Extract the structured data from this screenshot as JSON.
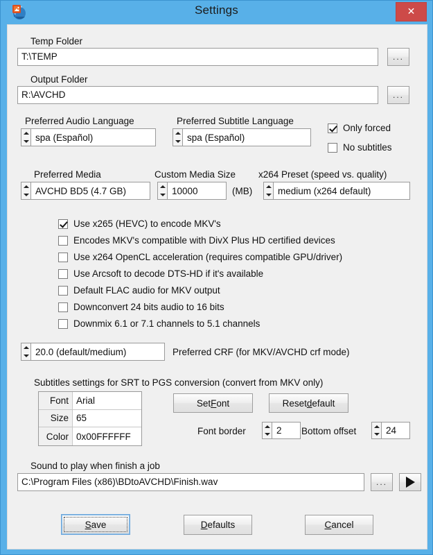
{
  "window": {
    "title": "Settings",
    "close_label": "✕",
    "app_icon": "bdtoavchd-app-icon",
    "accent_color": "#58b0e8",
    "close_color": "#cd4a48",
    "client_bg": "#f0f0f0"
  },
  "temp_folder": {
    "label": "Temp Folder",
    "value": "T:\\TEMP",
    "browse_label": "..."
  },
  "output_folder": {
    "label": "Output Folder",
    "value": "R:\\AVCHD",
    "browse_label": "..."
  },
  "audio_language": {
    "label": "Preferred Audio Language",
    "value": "spa (Español)"
  },
  "subtitle_language": {
    "label": "Preferred Subtitle Language",
    "value": "spa (Español)"
  },
  "subtitle_options": [
    {
      "label": "Only forced",
      "checked": true
    },
    {
      "label": "No subtitles",
      "checked": false
    }
  ],
  "preferred_media": {
    "label": "Preferred Media",
    "value": "AVCHD BD5 (4.7 GB)"
  },
  "custom_media_size": {
    "label": "Custom Media Size",
    "value": "10000",
    "unit": "(MB)"
  },
  "x264_preset": {
    "label": "x264 Preset (speed vs. quality)",
    "value": "medium (x264 default)"
  },
  "encode_options": [
    {
      "label": "Use x265 (HEVC) to encode MKV's",
      "checked": true
    },
    {
      "label": "Encodes MKV's compatible with DivX Plus HD certified devices",
      "checked": false
    },
    {
      "label": "Use x264 OpenCL acceleration (requires compatible GPU/driver)",
      "checked": false
    },
    {
      "label": "Use Arcsoft to decode DTS-HD if it's available",
      "checked": false
    },
    {
      "label": "Default FLAC audio for MKV output",
      "checked": false
    },
    {
      "label": "Downconvert 24 bits audio to 16 bits",
      "checked": false
    },
    {
      "label": "Downmix 6.1 or 7.1 channels to 5.1 channels",
      "checked": false
    }
  ],
  "crf": {
    "value": "20.0 (default/medium)",
    "label": "Preferred CRF (for MKV/AVCHD crf mode)"
  },
  "subtitles_section": {
    "heading": "Subtitles settings for SRT to PGS conversion (convert from MKV only)",
    "rows": [
      {
        "key": "Font",
        "value": "Arial"
      },
      {
        "key": "Size",
        "value": "65"
      },
      {
        "key": "Color",
        "value": "0x00FFFFFF"
      }
    ],
    "set_font_button": {
      "pre": "Set ",
      "accel": "F",
      "post": "ont"
    },
    "reset_default_button": {
      "pre": "Reset ",
      "accel": "d",
      "post": "efault"
    },
    "font_border": {
      "label": "Font border",
      "value": "2"
    },
    "bottom_offset": {
      "label": "Bottom offset",
      "value": "24"
    }
  },
  "sound": {
    "label": "Sound to play when finish a job",
    "value": "C:\\Program Files (x86)\\BDtoAVCHD\\Finish.wav",
    "browse_label": "...",
    "play_icon": "play-triangle-icon"
  },
  "footer": {
    "save": {
      "pre": "",
      "accel": "S",
      "post": "ave"
    },
    "defaults": {
      "pre": "",
      "accel": "D",
      "post": "efaults"
    },
    "cancel": {
      "pre": "",
      "accel": "C",
      "post": "ancel"
    }
  }
}
